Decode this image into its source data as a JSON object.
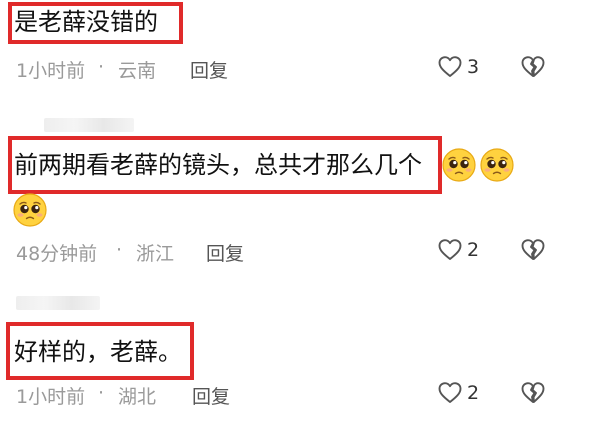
{
  "comments": [
    {
      "text": "是老薛没错的",
      "time": "1小时前",
      "dot": "·",
      "location": "云南",
      "reply_label": "回复",
      "likes": "3"
    },
    {
      "text": "前两期看老薛的镜头，总共才那么几个",
      "time": "48分钟前",
      "dot": "·",
      "location": "浙江",
      "reply_label": "回复",
      "likes": "2"
    },
    {
      "text": "好样的，老薛。",
      "time": "1小时前",
      "dot": "·",
      "location": "湖北",
      "reply_label": "回复",
      "likes": "2"
    }
  ],
  "icons": {
    "like": "heart-outline-icon",
    "dislike": "broken-heart-icon",
    "emoji": "pleading-face-emoji"
  },
  "colors": {
    "highlight_border": "#e02a2a",
    "meta_text": "#9a9a9a"
  }
}
